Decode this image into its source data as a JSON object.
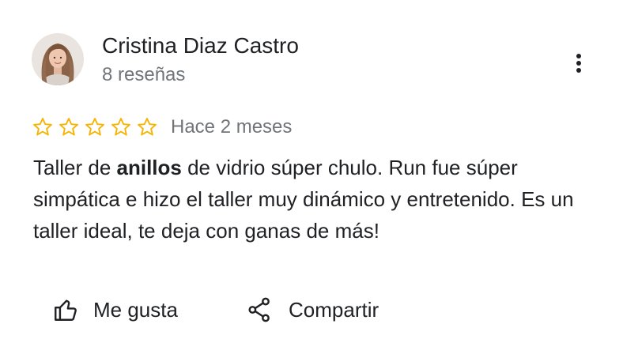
{
  "review": {
    "author": {
      "name": "Cristina Diaz Castro",
      "reviews_count": "8 reseñas",
      "avatar_icon": "user-photo-avatar"
    },
    "rating": 5,
    "rating_max": 5,
    "date": "Hace 2 meses",
    "text": {
      "part1": "Taller de ",
      "bold": "anillos",
      "part2": " de vidrio súper chulo. Run fue súper simpática e hizo el taller muy dinámico y entretenido. Es un taller ideal, te deja con ganas de más!"
    },
    "more_icon": "more-vert-icon"
  },
  "actions": {
    "like_label": "Me gusta",
    "like_icon": "thumbs-up-icon",
    "share_label": "Compartir",
    "share_icon": "share-icon"
  },
  "colors": {
    "star": "#f4b400",
    "primary_text": "#202124",
    "secondary_text": "#70757a"
  }
}
